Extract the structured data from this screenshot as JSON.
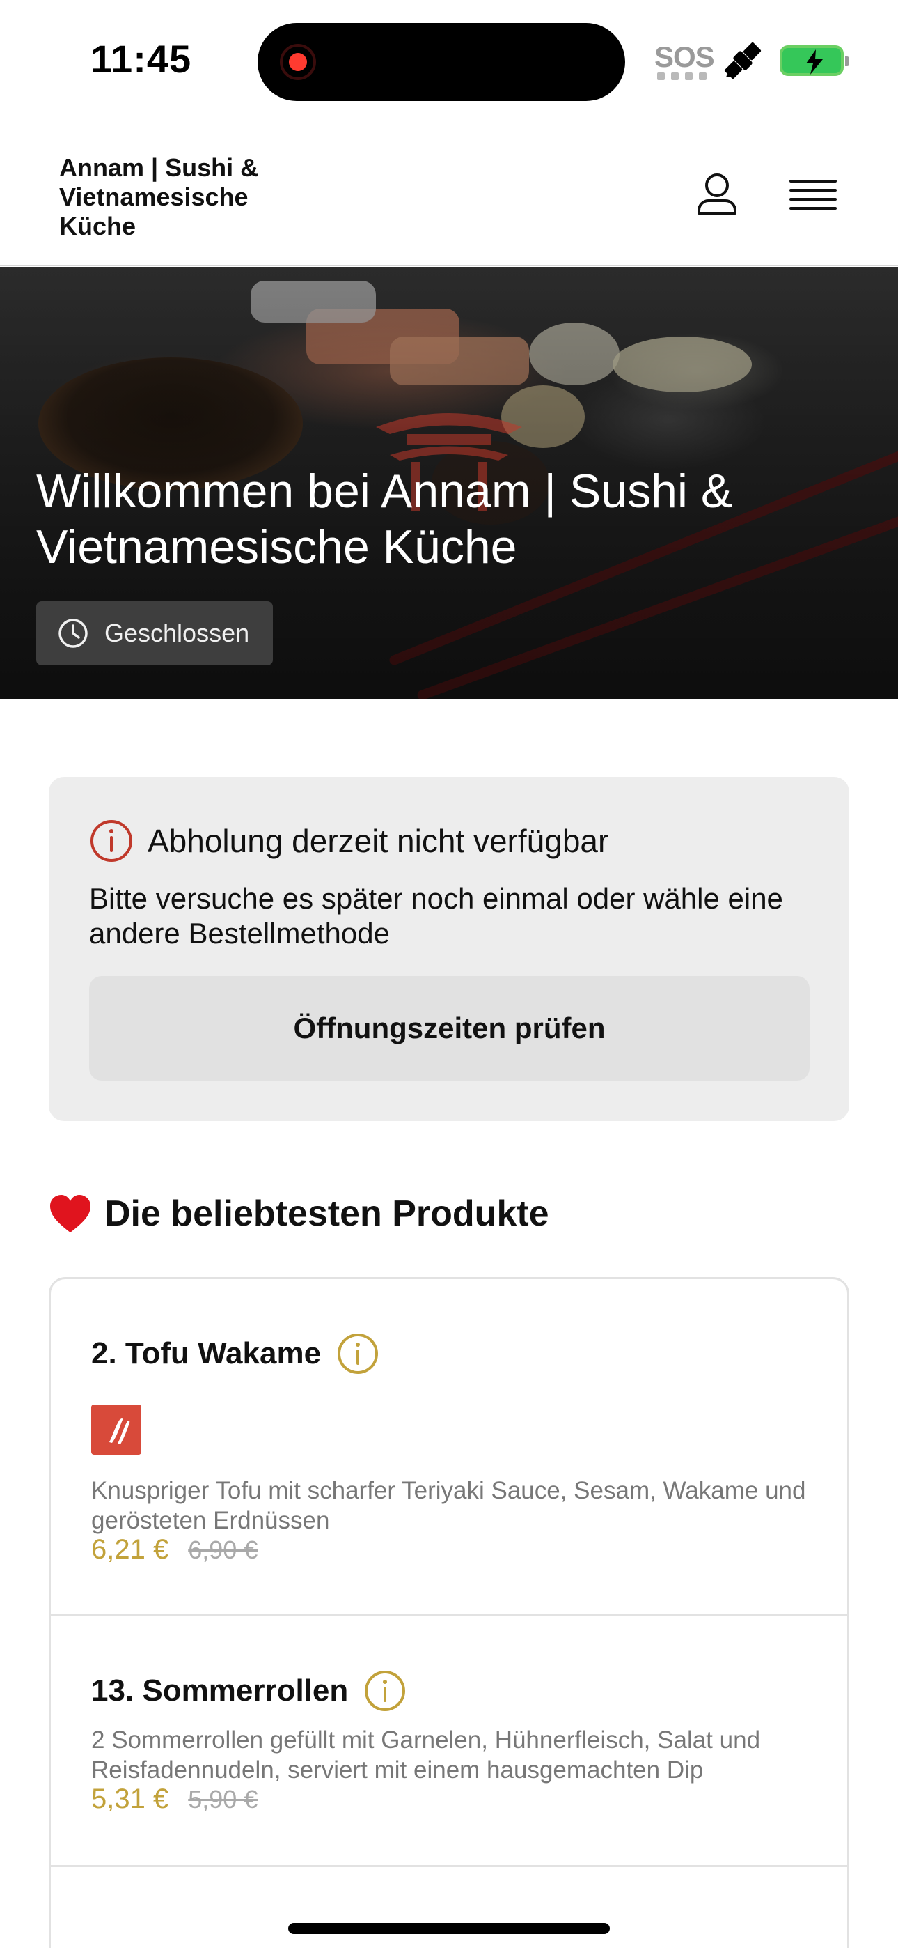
{
  "status_bar": {
    "time": "11:45",
    "sos_label": "SOS",
    "icons": [
      "recording-indicator",
      "satellite-icon",
      "battery-charging-icon"
    ]
  },
  "header": {
    "brand": "Annam | Sushi & Vietnamesische Küche",
    "icons": [
      "user-icon",
      "hamburger-menu-icon"
    ]
  },
  "hero": {
    "title": "Willkommen bei Annam | Sushi & Vietnamesische Küche",
    "status_label": "Geschlossen",
    "status_icon": "clock-icon"
  },
  "notice": {
    "title": "Abholung derzeit nicht verfügbar",
    "message": "Bitte versuche es später noch einmal oder wähle eine andere Bestellmethode",
    "button_label": "Öffnungszeiten prüfen",
    "icon": "info-icon",
    "icon_color": "#c0392b"
  },
  "popular": {
    "title": "Die beliebtesten Produkte",
    "icon": "heart-icon",
    "items": [
      {
        "name": "2. Tofu Wakame",
        "badge": "spicy",
        "description": "Knuspriger Tofu mit scharfer Teriyaki Sauce, Sesam, Wakame und gerösteten Erdnüssen",
        "price": "6,21 €",
        "old_price": "6,90 €"
      },
      {
        "name": "13. Sommerrollen",
        "description": "2 Sommerrollen gefüllt mit Garnelen, Hühnerfleisch, Salat und Reisfadennudeln, serviert mit einem hausgemachten Dip",
        "price": "5,31 €",
        "old_price": "5,90 €"
      }
    ]
  },
  "colors": {
    "accent_price": "#c2a23b",
    "spicy_badge": "#d84a3a",
    "notice_bg": "#ededed"
  }
}
